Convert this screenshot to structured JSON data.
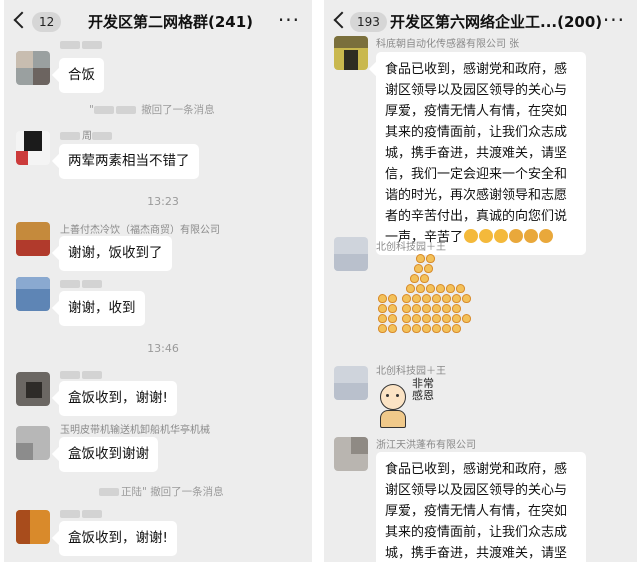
{
  "left": {
    "badge": "12",
    "title": "开发区第二网格群(241)",
    "messages": {
      "m1_text": "合饭",
      "recall1_name": "\"",
      "recall1_text": "撤回了一条消息",
      "m2_sender": "周",
      "m2_text": "两荤两素相当不错了",
      "time1": "13:23",
      "m3_sender": "上善付杰冷饮（福杰商贸）有限公司",
      "m3_text": "谢谢，饭收到了",
      "m4_text": "谢谢，收到",
      "time2": "13:46",
      "m5_text": "盒饭收到，谢谢!",
      "m6_sender": "玉明皮带机输送机卸船机华亭机械",
      "m6_text": "盒饭收到谢谢",
      "recall2_name": "正陆\"",
      "recall2_text": "撤回了一条消息",
      "m7_text": "盒饭收到，谢谢!"
    }
  },
  "right": {
    "badge": "193",
    "title": "开发区第六网络企业工...(200)",
    "messages": {
      "m1_sender": "科底朝自动化传感器有限公司 张",
      "m1_text": "食品已收到，感谢党和政府，感谢区领导以及园区领导的关心与厚爱，疫情无情人有情，在突如其来的疫情面前，让我们众志成城，携手奋进，共渡难关，请坚信，我们一定会迎来一个安全和谐的时光，再次感谢领导和志愿者的辛苦付出，真诚的向您们说一声，辛苦了",
      "m2_sender": "北创科技园＋王",
      "m3_sender": "北创科技园＋王",
      "sticker_text": "非常感恩",
      "m4_sender": "浙江天洪蓬布有限公司",
      "m4_text": "食品已收到，感谢党和政府，感谢区领导以及园区领导的关心与厚爱，疫情无情人有情，在突如其来的疫情面前，让我们众志成城，携手奋进，共渡难关，请坚"
    }
  },
  "icons": {
    "back": "chevron-left-icon",
    "more": "more-dots-icon"
  }
}
